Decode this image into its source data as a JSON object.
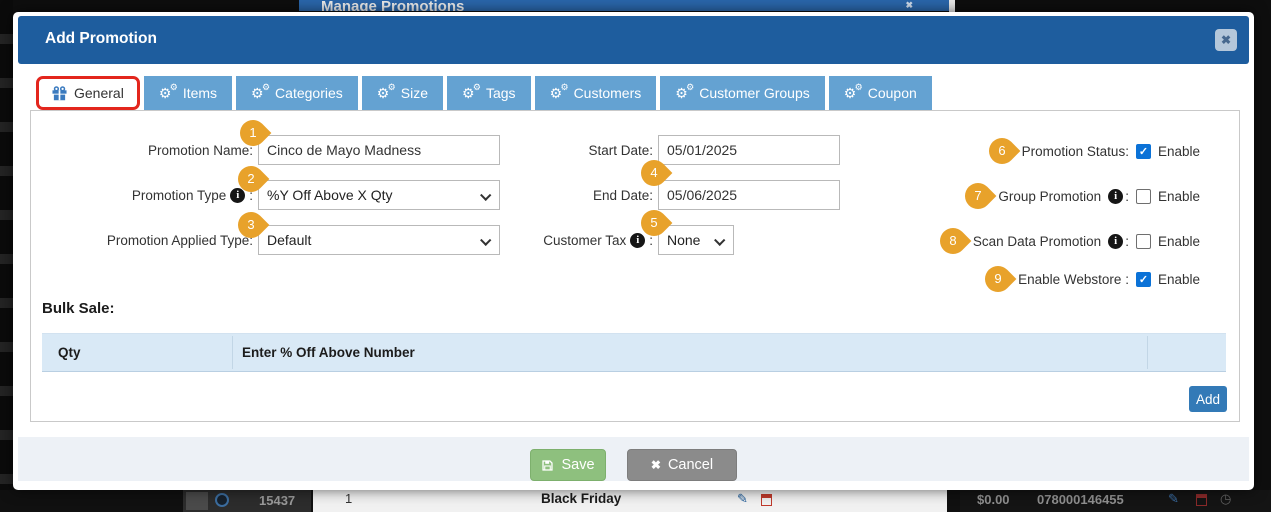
{
  "strings": {
    "colon": ":"
  },
  "icons": {
    "gear": "⚙",
    "check": "✓",
    "close": "✖",
    "info": "i",
    "pencil": "✎",
    "clock": "◷"
  },
  "colors": {
    "header_blue": "#1e5d9e",
    "tab_blue": "#64a2d2",
    "marker_orange": "#e8a22b",
    "annotation_red": "#e3261d",
    "add_blue": "#337ab7",
    "save_green": "#8ec07e",
    "cancel_gray": "#8b8b8b"
  },
  "background": {
    "top_title": "Manage Promotions",
    "bottom_row": {
      "id": "15437",
      "col1": "1",
      "name": "Black Friday",
      "price": "$0.00",
      "upc": "078000146455"
    }
  },
  "modal": {
    "title": "Add Promotion",
    "tabs": [
      {
        "label": "General",
        "active": true
      },
      {
        "label": "Items"
      },
      {
        "label": "Categories"
      },
      {
        "label": "Size"
      },
      {
        "label": "Tags"
      },
      {
        "label": "Customers"
      },
      {
        "label": "Customer Groups"
      },
      {
        "label": "Coupon"
      }
    ],
    "form": {
      "promotion_name": {
        "marker": "1",
        "label": "Promotion Name:",
        "value": "Cinco de Mayo Madness"
      },
      "promotion_type": {
        "marker": "2",
        "label": "Promotion Type",
        "value": "%Y Off Above X Qty"
      },
      "promotion_applied_type": {
        "marker": "3",
        "label": "Promotion Applied Type:",
        "value": "Default"
      },
      "start_date": {
        "label": "Start Date:",
        "value": "05/01/2025"
      },
      "end_date": {
        "marker": "4",
        "label": "End Date:",
        "value": "05/06/2025"
      },
      "customer_tax": {
        "marker": "5",
        "label": "Customer Tax",
        "value": "None"
      },
      "promotion_status": {
        "marker": "6",
        "label": "Promotion Status:",
        "checked": true,
        "checkbox_label": "Enable"
      },
      "group_promotion": {
        "marker": "7",
        "label": "Group Promotion",
        "checked": false,
        "checkbox_label": "Enable"
      },
      "scan_data_promotion": {
        "marker": "8",
        "label": "Scan Data Promotion",
        "checked": false,
        "checkbox_label": "Enable"
      },
      "enable_webstore": {
        "marker": "9",
        "label": "Enable Webstore :",
        "checked": true,
        "checkbox_label": "Enable"
      }
    },
    "bulk_sale": {
      "title": "Bulk Sale:",
      "col_qty": "Qty",
      "col_percent": "Enter % Off Above Number",
      "add_label": "Add"
    },
    "footer": {
      "save_label": "Save",
      "cancel_label": "Cancel"
    }
  }
}
